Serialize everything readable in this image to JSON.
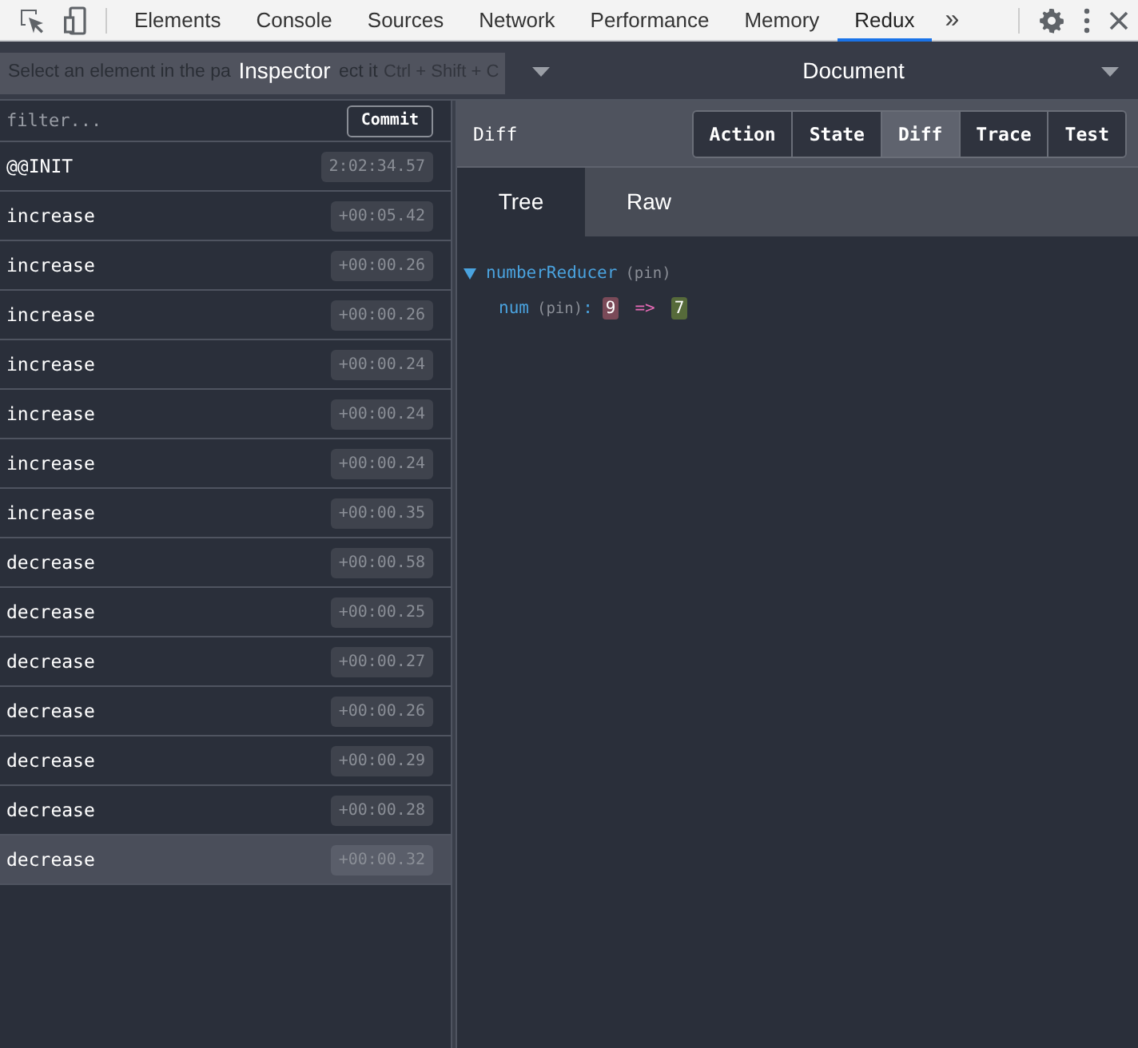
{
  "devtools_tabs": [
    {
      "label": "Elements",
      "selected": false
    },
    {
      "label": "Console",
      "selected": false
    },
    {
      "label": "Sources",
      "selected": false
    },
    {
      "label": "Network",
      "selected": false
    },
    {
      "label": "Performance",
      "selected": false
    },
    {
      "label": "Memory",
      "selected": false
    },
    {
      "label": "Redux",
      "selected": true
    }
  ],
  "overflow": "»",
  "tooltip": {
    "text_parts": [
      "Select an element in the pa",
      "ect it"
    ],
    "shortcut": "Ctrl + Shift + C"
  },
  "monitor_selectors": [
    {
      "label": "Inspector"
    },
    {
      "label": "Document"
    }
  ],
  "filter": {
    "placeholder": "filter..."
  },
  "commit_button": "Commit",
  "actions": [
    {
      "name": "@@INIT",
      "time": "2:02:34.57",
      "selected": false
    },
    {
      "name": "increase",
      "time": "+00:05.42",
      "selected": false
    },
    {
      "name": "increase",
      "time": "+00:00.26",
      "selected": false
    },
    {
      "name": "increase",
      "time": "+00:00.26",
      "selected": false
    },
    {
      "name": "increase",
      "time": "+00:00.24",
      "selected": false
    },
    {
      "name": "increase",
      "time": "+00:00.24",
      "selected": false
    },
    {
      "name": "increase",
      "time": "+00:00.24",
      "selected": false
    },
    {
      "name": "increase",
      "time": "+00:00.35",
      "selected": false
    },
    {
      "name": "decrease",
      "time": "+00:00.58",
      "selected": false
    },
    {
      "name": "decrease",
      "time": "+00:00.25",
      "selected": false
    },
    {
      "name": "decrease",
      "time": "+00:00.27",
      "selected": false
    },
    {
      "name": "decrease",
      "time": "+00:00.26",
      "selected": false
    },
    {
      "name": "decrease",
      "time": "+00:00.29",
      "selected": false
    },
    {
      "name": "decrease",
      "time": "+00:00.28",
      "selected": false
    },
    {
      "name": "decrease",
      "time": "+00:00.32",
      "selected": true
    }
  ],
  "detail": {
    "title": "Diff",
    "tabs": [
      {
        "label": "Action",
        "selected": false
      },
      {
        "label": "State",
        "selected": false
      },
      {
        "label": "Diff",
        "selected": true
      },
      {
        "label": "Trace",
        "selected": false
      },
      {
        "label": "Test",
        "selected": false
      }
    ],
    "subtabs": [
      {
        "label": "Tree",
        "selected": true
      },
      {
        "label": "Raw",
        "selected": false
      }
    ],
    "tree": [
      {
        "key": "numberReducer",
        "tag": "(pin)",
        "expanded": true,
        "children": [
          {
            "key": "num",
            "tag": "(pin)",
            "separator": ":",
            "old": "9",
            "arrow": "=>",
            "new": "7"
          }
        ]
      }
    ]
  }
}
